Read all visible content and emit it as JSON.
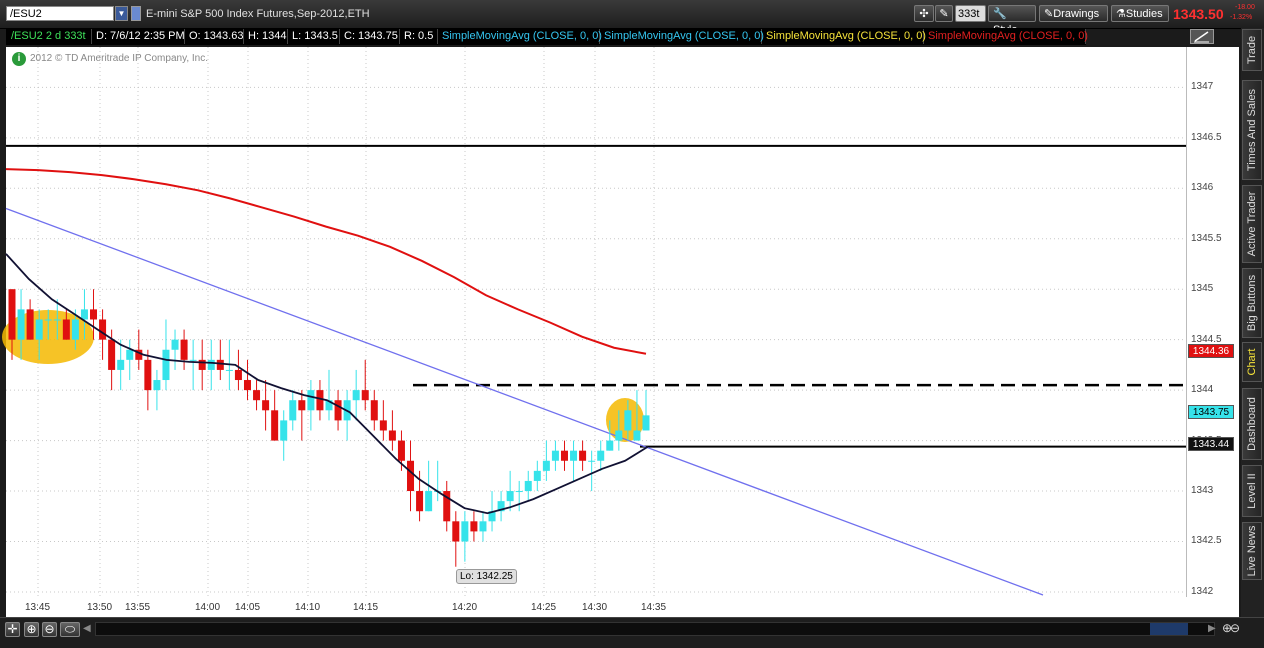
{
  "toolbar": {
    "symbol": "/ESU2",
    "description": "E-mini S&P 500 Index Futures,Sep-2012,ETH",
    "aggregation": "333t",
    "style_label": "Style",
    "drawings_label": "Drawings",
    "studies_label": "Studies",
    "last_price": "1343.50",
    "change_top": "-18.00",
    "change_pct": "-1.32%"
  },
  "info_bar": {
    "symbol_info": "/ESU2 2 d 333t",
    "date": "D: 7/6/12 2:35 PM",
    "open": "O: 1343.63",
    "high": "H: 1344",
    "low": "L: 1343.5",
    "close": "C: 1343.75",
    "range": "R: 0.5",
    "studies": [
      {
        "label": "SimpleMovingAvg (CLOSE, 0, 0)",
        "color": "#35c6f0"
      },
      {
        "label": "SimpleMovingAvg (CLOSE, 0, 0)",
        "color": "#35c6f0"
      },
      {
        "label": "SimpleMovingAvg (CLOSE, 0, 0)",
        "color": "#f5e23a"
      },
      {
        "label": "SimpleMovingAvg (CLOSE, 0, 0)",
        "color": "#e02020"
      }
    ]
  },
  "chart": {
    "copyright": "2012 © TD Ameritrade IP Company, Inc.",
    "low_label": "Lo: 1342.25",
    "price_labels": {
      "red_sma": "1344.36",
      "current": "1343.75",
      "black_sma": "1343.44"
    }
  },
  "side_tabs": [
    "Trade",
    "Times And Sales",
    "Active Trader",
    "Big Buttons",
    "Chart",
    "Dashboard",
    "Level II",
    "Live News"
  ],
  "chart_data": {
    "type": "candlestick",
    "y_ticks": [
      "1347",
      "1346.5",
      "1346",
      "1345.5",
      "1345",
      "1344.5",
      "1344",
      "1343.5",
      "1343",
      "1342.5",
      "1342"
    ],
    "x_ticks": [
      "13:45",
      "13:50",
      "13:55",
      "14:00",
      "14:05",
      "14:10",
      "14:15",
      "14:20",
      "14:25",
      "14:30",
      "14:35"
    ],
    "ylim": [
      1341.95,
      1347.4
    ],
    "candles": [
      [
        1345.0,
        1345.0,
        1344.3,
        1344.5
      ],
      [
        1344.5,
        1345.0,
        1344.3,
        1344.8
      ],
      [
        1344.8,
        1344.9,
        1344.5,
        1344.5
      ],
      [
        1344.5,
        1344.8,
        1344.3,
        1344.7
      ],
      [
        1344.7,
        1344.8,
        1344.5,
        1344.7
      ],
      [
        1344.7,
        1344.9,
        1344.5,
        1344.7
      ],
      [
        1344.7,
        1344.8,
        1344.5,
        1344.5
      ],
      [
        1344.5,
        1344.8,
        1344.4,
        1344.7
      ],
      [
        1344.7,
        1345.0,
        1344.5,
        1344.8
      ],
      [
        1344.8,
        1345.0,
        1344.5,
        1344.7
      ],
      [
        1344.7,
        1344.8,
        1344.3,
        1344.5
      ],
      [
        1344.5,
        1344.6,
        1344.0,
        1344.2
      ],
      [
        1344.2,
        1344.5,
        1344.0,
        1344.3
      ],
      [
        1344.3,
        1344.5,
        1344.1,
        1344.4
      ],
      [
        1344.4,
        1344.6,
        1344.2,
        1344.3
      ],
      [
        1344.3,
        1344.4,
        1343.8,
        1344.0
      ],
      [
        1344.0,
        1344.2,
        1343.8,
        1344.1
      ],
      [
        1344.1,
        1344.7,
        1344.0,
        1344.4
      ],
      [
        1344.4,
        1344.6,
        1344.2,
        1344.5
      ],
      [
        1344.5,
        1344.6,
        1344.2,
        1344.3
      ],
      [
        1344.3,
        1344.5,
        1344.0,
        1344.3
      ],
      [
        1344.3,
        1344.5,
        1344.0,
        1344.2
      ],
      [
        1344.2,
        1344.5,
        1344.0,
        1344.3
      ],
      [
        1344.3,
        1344.5,
        1344.1,
        1344.2
      ],
      [
        1344.2,
        1344.5,
        1344.0,
        1344.2
      ],
      [
        1344.2,
        1344.4,
        1344.0,
        1344.1
      ],
      [
        1344.1,
        1344.3,
        1343.9,
        1344.0
      ],
      [
        1344.0,
        1344.1,
        1343.8,
        1343.9
      ],
      [
        1343.9,
        1344.1,
        1343.6,
        1343.8
      ],
      [
        1343.8,
        1344.0,
        1343.5,
        1343.5
      ],
      [
        1343.5,
        1343.8,
        1343.3,
        1343.7
      ],
      [
        1343.7,
        1344.0,
        1343.6,
        1343.9
      ],
      [
        1343.9,
        1344.0,
        1343.5,
        1343.8
      ],
      [
        1343.8,
        1344.1,
        1343.6,
        1344.0
      ],
      [
        1344.0,
        1344.1,
        1343.7,
        1343.8
      ],
      [
        1343.8,
        1344.2,
        1343.7,
        1343.9
      ],
      [
        1343.9,
        1344.0,
        1343.6,
        1343.7
      ],
      [
        1343.7,
        1344.0,
        1343.5,
        1343.9
      ],
      [
        1343.9,
        1344.2,
        1343.7,
        1344.0
      ],
      [
        1344.0,
        1344.3,
        1343.8,
        1343.9
      ],
      [
        1343.9,
        1344.0,
        1343.6,
        1343.7
      ],
      [
        1343.7,
        1343.9,
        1343.5,
        1343.6
      ],
      [
        1343.6,
        1343.8,
        1343.4,
        1343.5
      ],
      [
        1343.5,
        1343.6,
        1343.2,
        1343.3
      ],
      [
        1343.3,
        1343.5,
        1342.8,
        1343.0
      ],
      [
        1343.0,
        1343.2,
        1342.7,
        1342.8
      ],
      [
        1342.8,
        1343.3,
        1342.8,
        1343.0
      ],
      [
        1343.0,
        1343.3,
        1342.9,
        1343.0
      ],
      [
        1343.0,
        1343.1,
        1342.6,
        1342.7
      ],
      [
        1342.7,
        1342.8,
        1342.25,
        1342.5
      ],
      [
        1342.5,
        1342.8,
        1342.3,
        1342.7
      ],
      [
        1342.7,
        1342.8,
        1342.5,
        1342.6
      ],
      [
        1342.6,
        1342.8,
        1342.5,
        1342.7
      ],
      [
        1342.7,
        1343.0,
        1342.6,
        1342.8
      ],
      [
        1342.8,
        1343.0,
        1342.7,
        1342.9
      ],
      [
        1342.9,
        1343.2,
        1342.8,
        1343.0
      ],
      [
        1343.0,
        1343.1,
        1342.8,
        1343.0
      ],
      [
        1343.0,
        1343.2,
        1342.9,
        1343.1
      ],
      [
        1343.1,
        1343.3,
        1343.0,
        1343.2
      ],
      [
        1343.2,
        1343.5,
        1343.1,
        1343.3
      ],
      [
        1343.3,
        1343.5,
        1343.2,
        1343.4
      ],
      [
        1343.4,
        1343.5,
        1343.2,
        1343.3
      ],
      [
        1343.3,
        1343.5,
        1343.1,
        1343.4
      ],
      [
        1343.4,
        1343.5,
        1343.2,
        1343.3
      ],
      [
        1343.3,
        1343.4,
        1343.0,
        1343.3
      ],
      [
        1343.3,
        1343.5,
        1343.2,
        1343.4
      ],
      [
        1343.4,
        1343.7,
        1343.4,
        1343.5
      ],
      [
        1343.5,
        1343.8,
        1343.4,
        1343.6
      ],
      [
        1343.6,
        1343.9,
        1343.5,
        1343.8
      ],
      [
        1343.5,
        1344.0,
        1343.5,
        1343.6
      ],
      [
        1343.6,
        1344.0,
        1343.6,
        1343.75
      ]
    ],
    "up_color": "#36e3ea",
    "down_color": "#e01010",
    "sma_red": [
      1346.19,
      1346.18,
      1346.16,
      1346.13,
      1346.09,
      1346.04,
      1345.98,
      1345.9,
      1345.81,
      1345.72,
      1345.62,
      1345.53,
      1345.42,
      1345.28,
      1345.12,
      1344.94,
      1344.8,
      1344.67,
      1344.53,
      1344.42,
      1344.36
    ],
    "sma_black": [
      1345.35,
      1345.1,
      1344.9,
      1344.75,
      1344.6,
      1344.45,
      1344.35,
      1344.3,
      1344.28,
      1344.27,
      1344.25,
      1344.1,
      1344.02,
      1343.95,
      1343.9,
      1343.78,
      1343.55,
      1343.32,
      1343.12,
      1342.97,
      1342.83,
      1342.78,
      1342.84,
      1342.92,
      1343.02,
      1343.12,
      1343.22,
      1343.3,
      1343.44
    ],
    "trend_line": [
      [
        1345.8,
        0
      ],
      [
        1341.97,
        1
      ]
    ],
    "horizontal_levels": {
      "solid_top": 1346.42,
      "dashed": 1344.05,
      "solid_current": 1343.44
    }
  },
  "colors": {
    "accent": "#3a5a9a",
    "price_red": "#ff3030",
    "trend": "#7070ee"
  }
}
